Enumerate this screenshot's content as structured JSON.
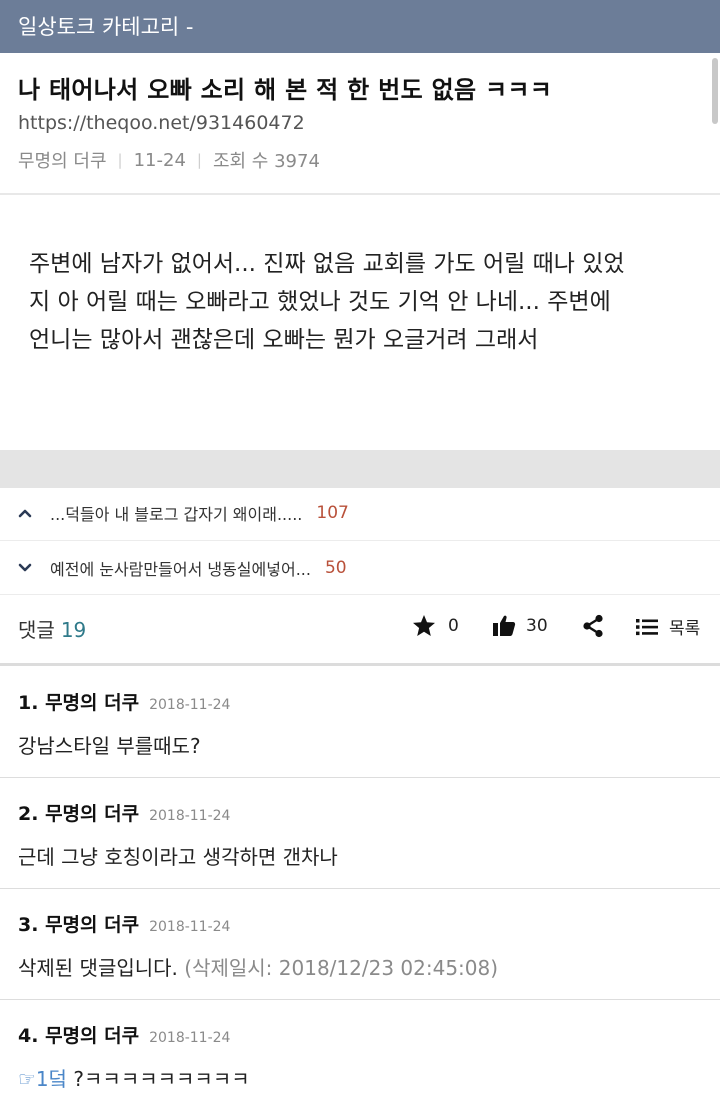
{
  "header": {
    "category": "일상토크 카테고리 -"
  },
  "post": {
    "title": "나 태어나서 오빠 소리 해 본 적 한 번도 없음 ㅋㅋㅋ",
    "url": "https://theqoo.net/931460472",
    "author": "무명의 더쿠",
    "date": "11-24",
    "views": "조회 수 3974",
    "body_lines": [
      "주변에 남자가 없어서... 진짜 없음 교회를 가도 어릴 때나 있었",
      "지 아 어릴 때는 오빠라고 했었나 것도 기억 안 나네... 주변에",
      "언니는 많아서 괜찮은데 오빠는 뭔가 오글거려 그래서"
    ]
  },
  "nav": {
    "prev": {
      "title": "...덕들아 내 블로그 갑자기 왜이래.....",
      "count": "107"
    },
    "next": {
      "title": "예전에 눈사람만들어서 냉동실에넣어...",
      "count": "50"
    }
  },
  "actions": {
    "comments_label": "댓글",
    "comments_count": "19",
    "star_count": "0",
    "like_count": "30",
    "list_label": "목록"
  },
  "comments": [
    {
      "number": "1.",
      "author": "무명의 더쿠",
      "date": "2018-11-24",
      "text": "강남스타일 부를때도?"
    },
    {
      "number": "2.",
      "author": "무명의 더쿠",
      "date": "2018-11-24",
      "text": "근데 그냥 호칭이라고 생각하면 갠차나"
    },
    {
      "number": "3.",
      "author": "무명의 더쿠",
      "date": "2018-11-24",
      "text": "삭제된 댓글입니다.",
      "deleted_note": "(삭제일시: 2018/12/23 02:45:08)"
    },
    {
      "number": "4.",
      "author": "무명의 더쿠",
      "date": "2018-11-24",
      "ref": "☞1덬",
      "text": " ?ㅋㅋㅋㅋㅋㅋㅋㅋㅋ"
    }
  ],
  "colors": {
    "topbar": "#6c7d98",
    "count_accent": "#b9513a",
    "comment_count": "#2f7a8a",
    "ref_link": "#4a86c8"
  }
}
